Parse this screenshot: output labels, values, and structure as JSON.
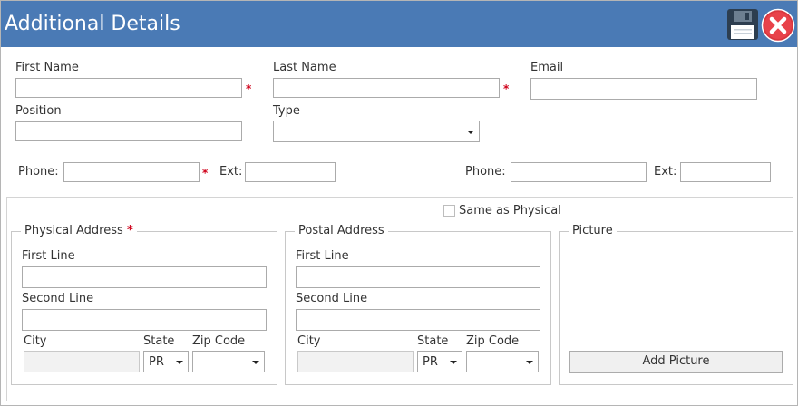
{
  "window": {
    "title": "Additional Details",
    "title_bar_color": "#4a7ab5",
    "save_icon": "floppy-disk-icon",
    "close_icon": "red-x-close-icon"
  },
  "contact": {
    "first_name": {
      "label": "First Name",
      "value": "",
      "required_mark": "*"
    },
    "last_name": {
      "label": "Last Name",
      "value": "",
      "required_mark": "*"
    },
    "email": {
      "label": "Email",
      "value": ""
    },
    "position": {
      "label": "Position",
      "value": ""
    },
    "type": {
      "label": "Type",
      "selected": ""
    },
    "phone1": {
      "label": "Phone:",
      "value": "",
      "required_mark": "*",
      "ext_label": "Ext:",
      "ext_value": ""
    },
    "phone2": {
      "label": "Phone:",
      "value": "",
      "ext_label": "Ext:",
      "ext_value": ""
    }
  },
  "addresses": {
    "same_as_physical": {
      "label": "Same as Physical",
      "checked": false
    },
    "physical": {
      "title": "Physical Address",
      "required_mark": "*",
      "first_line_label": "First Line",
      "second_line_label": "Second Line",
      "city_label": "City",
      "state_label": "State",
      "state_value": "PR",
      "zip_label": "Zip Code",
      "zip_value": ""
    },
    "postal": {
      "title": "Postal Address",
      "first_line_label": "First Line",
      "second_line_label": "Second Line",
      "city_label": "City",
      "state_label": "State",
      "state_value": "PR",
      "zip_label": "Zip Code",
      "zip_value": ""
    },
    "picture": {
      "title": "Picture",
      "add_button": "Add Picture"
    }
  },
  "colors": {
    "required": "#d0021b"
  }
}
